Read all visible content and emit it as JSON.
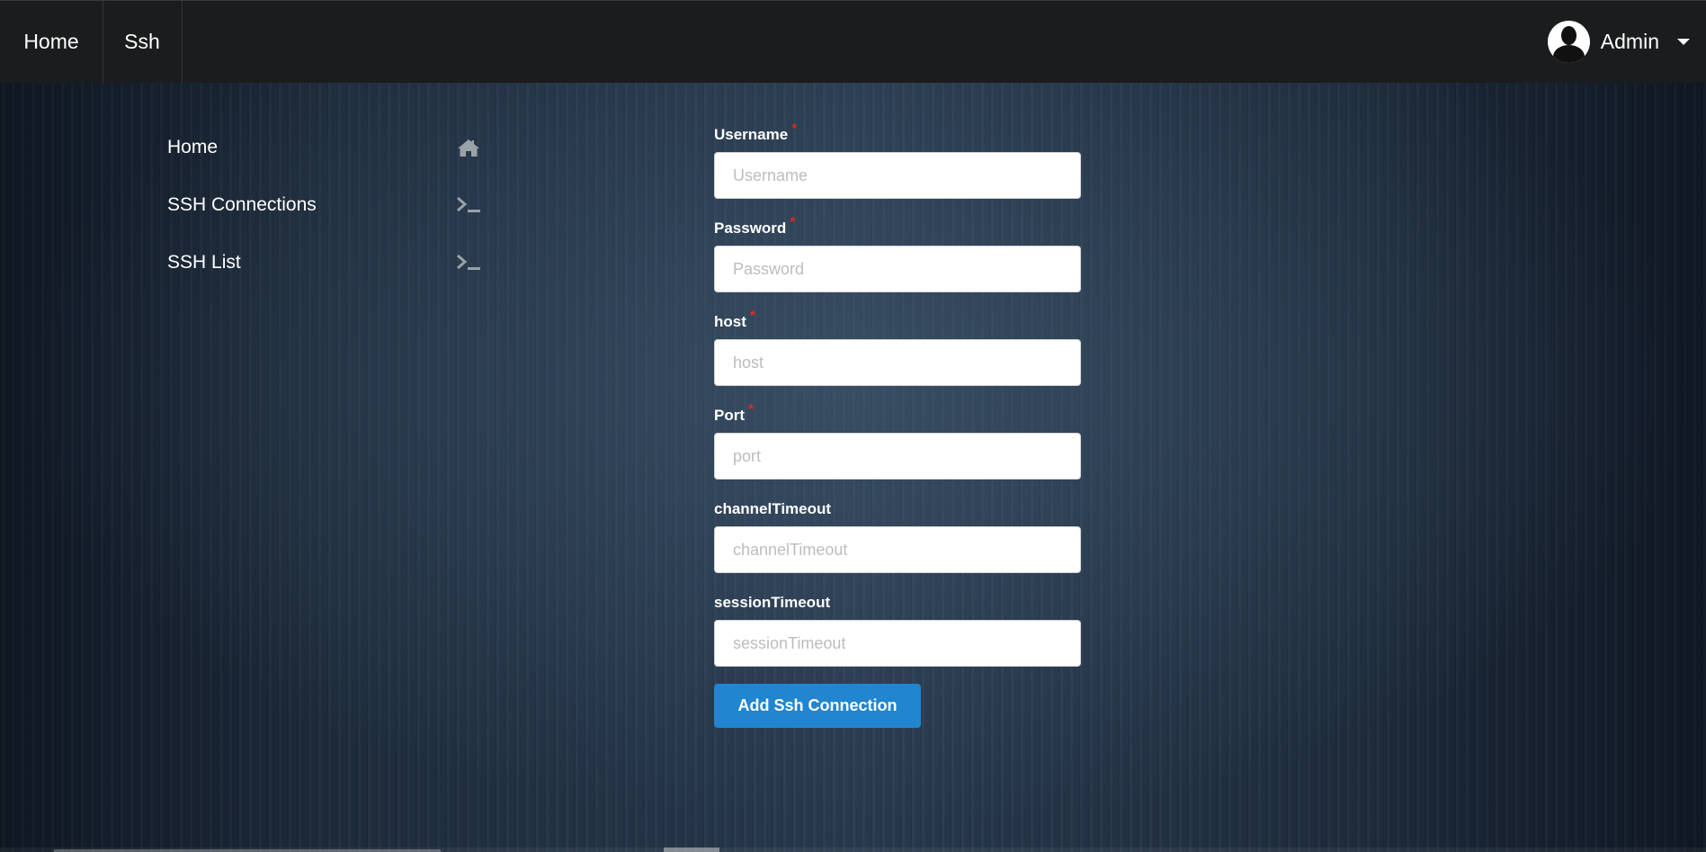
{
  "topnav": {
    "items": [
      {
        "label": "Home"
      },
      {
        "label": "Ssh"
      }
    ],
    "user": {
      "name": "Admin"
    }
  },
  "sidebar": {
    "items": [
      {
        "label": "Home",
        "icon": "home-icon"
      },
      {
        "label": "SSH Connections",
        "icon": "terminal-icon"
      },
      {
        "label": "SSH List",
        "icon": "terminal-icon"
      }
    ]
  },
  "form": {
    "fields": [
      {
        "label": "Username",
        "required": true,
        "placeholder": "Username",
        "value": ""
      },
      {
        "label": "Password",
        "required": true,
        "placeholder": "Password",
        "value": ""
      },
      {
        "label": "host",
        "required": true,
        "placeholder": "host",
        "value": ""
      },
      {
        "label": "Port",
        "required": true,
        "placeholder": "port",
        "value": ""
      },
      {
        "label": "channelTimeout",
        "required": false,
        "placeholder": "channelTimeout",
        "value": ""
      },
      {
        "label": "sessionTimeout",
        "required": false,
        "placeholder": "sessionTimeout",
        "value": ""
      }
    ],
    "required_marker": "*",
    "submit_label": "Add Ssh Connection"
  },
  "colors": {
    "nav_bg": "#1b1c1d",
    "primary_button": "#2185d0",
    "required_star": "#db2828"
  }
}
